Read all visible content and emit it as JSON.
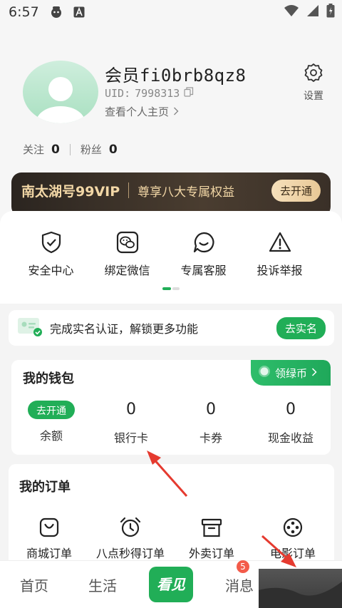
{
  "status_bar": {
    "time": "6:57"
  },
  "profile": {
    "username": "会员fi0brb8qz8",
    "uid_label": "UID:",
    "uid_value": "7998313",
    "homepage_link": "查看个人主页",
    "settings_label": "设置",
    "follow_label": "关注",
    "follow_count": "0",
    "fans_label": "粉丝",
    "fans_count": "0"
  },
  "vip": {
    "title": "南太湖号99VIP",
    "desc": "尊享八大专属权益",
    "button": "去开通"
  },
  "quick_actions": [
    {
      "label": "安全中心",
      "icon": "shield-check-icon"
    },
    {
      "label": "绑定微信",
      "icon": "wechat-icon"
    },
    {
      "label": "专属客服",
      "icon": "chat-bubble-icon"
    },
    {
      "label": "投诉举报",
      "icon": "warning-icon"
    }
  ],
  "realname": {
    "text": "完成实名认证，解锁更多功能",
    "button": "去实名"
  },
  "wallet": {
    "title": "我的钱包",
    "green_coin": "领绿币",
    "items": [
      {
        "value": "去开通",
        "label": "余额"
      },
      {
        "value": "0",
        "label": "银行卡"
      },
      {
        "value": "0",
        "label": "卡券"
      },
      {
        "value": "0",
        "label": "现金收益"
      }
    ]
  },
  "orders": {
    "title": "我的订单",
    "items": [
      {
        "label": "商城订单",
        "icon": "shopping-bag-icon"
      },
      {
        "label": "八点秒得订单",
        "icon": "alarm-clock-icon"
      },
      {
        "label": "外卖订单",
        "icon": "box-icon"
      },
      {
        "label": "电影订单",
        "icon": "film-reel-icon"
      }
    ]
  },
  "tabbar": {
    "items": [
      {
        "label": "首页"
      },
      {
        "label": "生活"
      },
      {
        "label": "看见"
      },
      {
        "label": "消息",
        "badge": "5"
      },
      {
        "label": ""
      }
    ]
  },
  "colors": {
    "accent": "#21ae57",
    "vip_gold": "#f2d7a6",
    "badge_red": "#f35b4a"
  }
}
